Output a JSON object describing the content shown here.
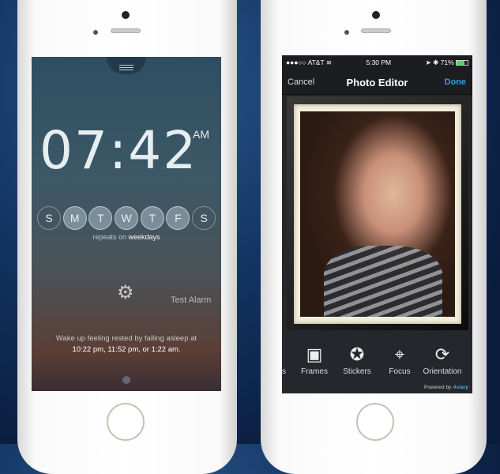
{
  "alarm_app": {
    "time": "07:42",
    "ampm": "AM",
    "days": [
      {
        "label": "S",
        "on": false
      },
      {
        "label": "M",
        "on": true
      },
      {
        "label": "T",
        "on": true
      },
      {
        "label": "W",
        "on": true
      },
      {
        "label": "T",
        "on": true
      },
      {
        "label": "F",
        "on": true
      },
      {
        "label": "S",
        "on": false
      }
    ],
    "repeats_prefix": "repeats on",
    "repeats_value": "weekdays",
    "test_alarm": "Test Alarm",
    "wake_line1": "Wake up feeling rested by falling asleep at",
    "wake_line2": "10:22 pm, 11:52 pm, or 1:22 am."
  },
  "photo_app": {
    "status": {
      "carrier": "●●●○○ AT&T",
      "wifi": "wifi-icon",
      "time": "5:30 PM",
      "battery": "71%"
    },
    "nav": {
      "cancel": "Cancel",
      "title": "Photo Editor",
      "done": "Done"
    },
    "tools": [
      {
        "label": "s",
        "icon": "cropped-icon"
      },
      {
        "label": "Frames",
        "icon": "frame-icon"
      },
      {
        "label": "Stickers",
        "icon": "sticker-icon"
      },
      {
        "label": "Focus",
        "icon": "focus-icon"
      },
      {
        "label": "Orientation",
        "icon": "rotate-icon"
      }
    ],
    "powered_by": "Powered by",
    "brand": "Aviary",
    "accent": "#2ba0d8"
  }
}
